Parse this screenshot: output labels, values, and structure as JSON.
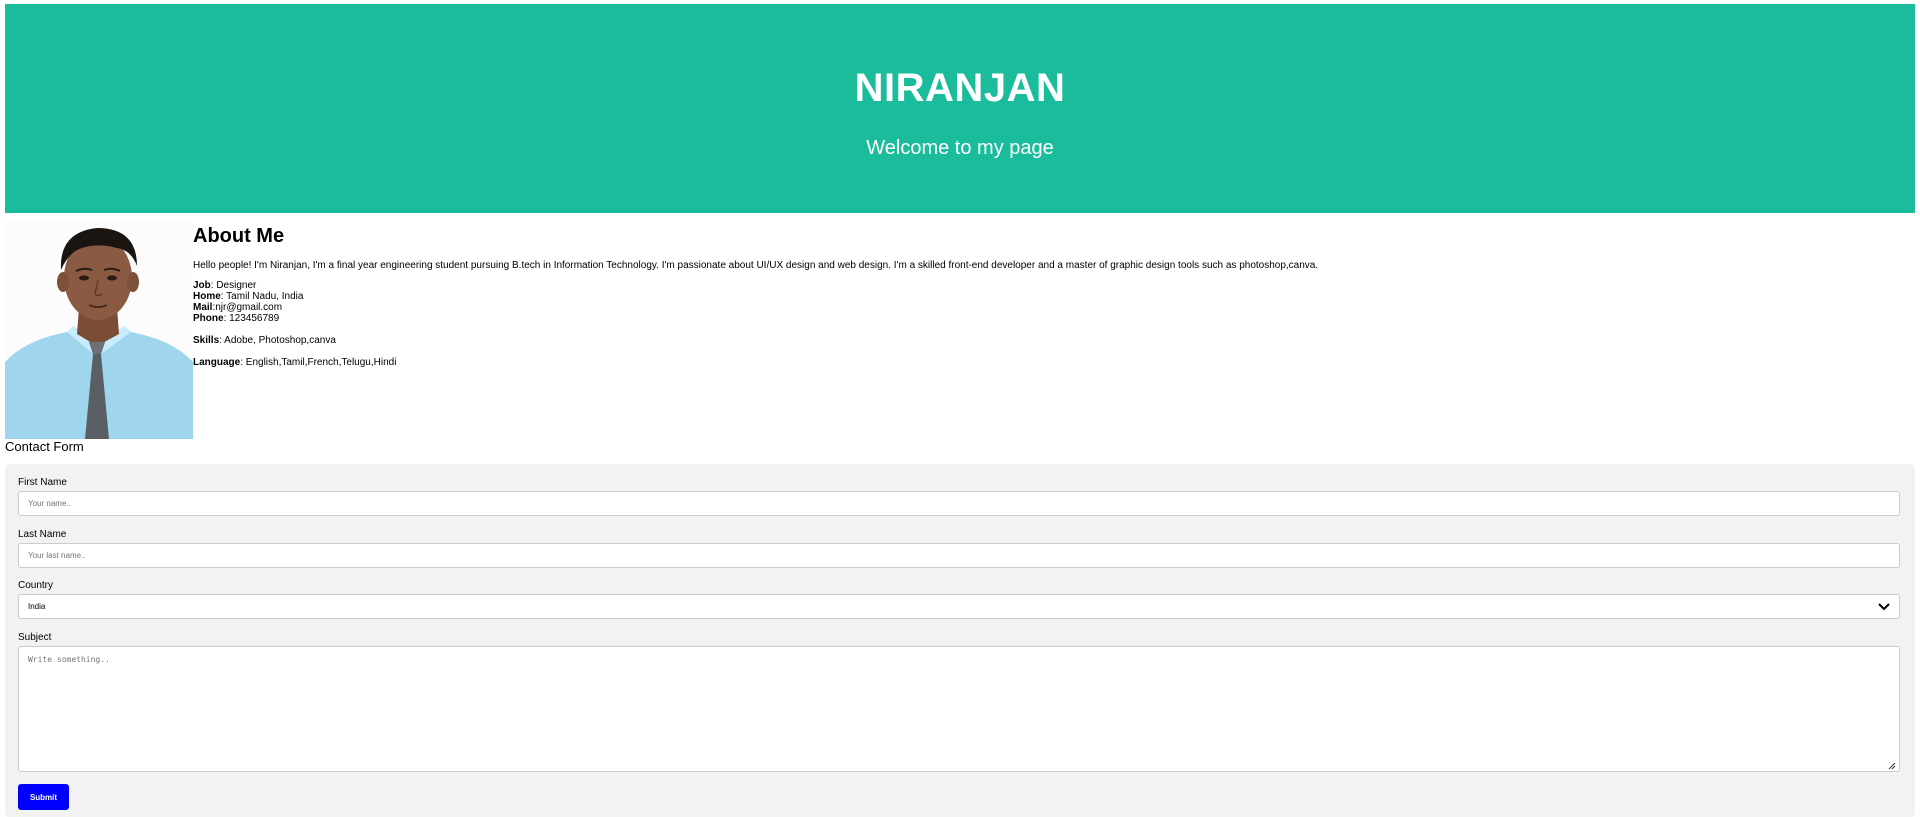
{
  "header": {
    "title": "NIRANJAN",
    "subtitle": "Welcome to my page",
    "bg_color": "#1abc9c"
  },
  "about": {
    "heading": "About Me",
    "intro": "Hello people! I'm Niranjan, I'm a final year engineering student pursuing B.tech in Information Technology. I'm passionate about UI/UX design and web design. I'm a skilled front-end developer and a master of graphic design tools such as photoshop,canva.",
    "job_label": "Job",
    "job_value": ": Designer",
    "home_label": "Home",
    "home_value": ": Tamil Nadu, India",
    "mail_label": "Mail",
    "mail_value": ":njr@gmail.com",
    "phone_label": "Phone",
    "phone_value": ": 123456789",
    "skills_label": "Skills",
    "skills_value": ": Adobe, Photoshop,canva",
    "language_label": "Language",
    "language_value": ": English,Tamil,French,Telugu,Hindi"
  },
  "contact": {
    "title": "Contact Form",
    "first_name_label": "First Name",
    "first_name_placeholder": "Your name..",
    "last_name_label": "Last Name",
    "last_name_placeholder": "Your last name..",
    "country_label": "Country",
    "country_selected": "India",
    "subject_label": "Subject",
    "subject_placeholder": "Write something..",
    "submit_label": "Submit",
    "submit_color": "#0000ff"
  }
}
